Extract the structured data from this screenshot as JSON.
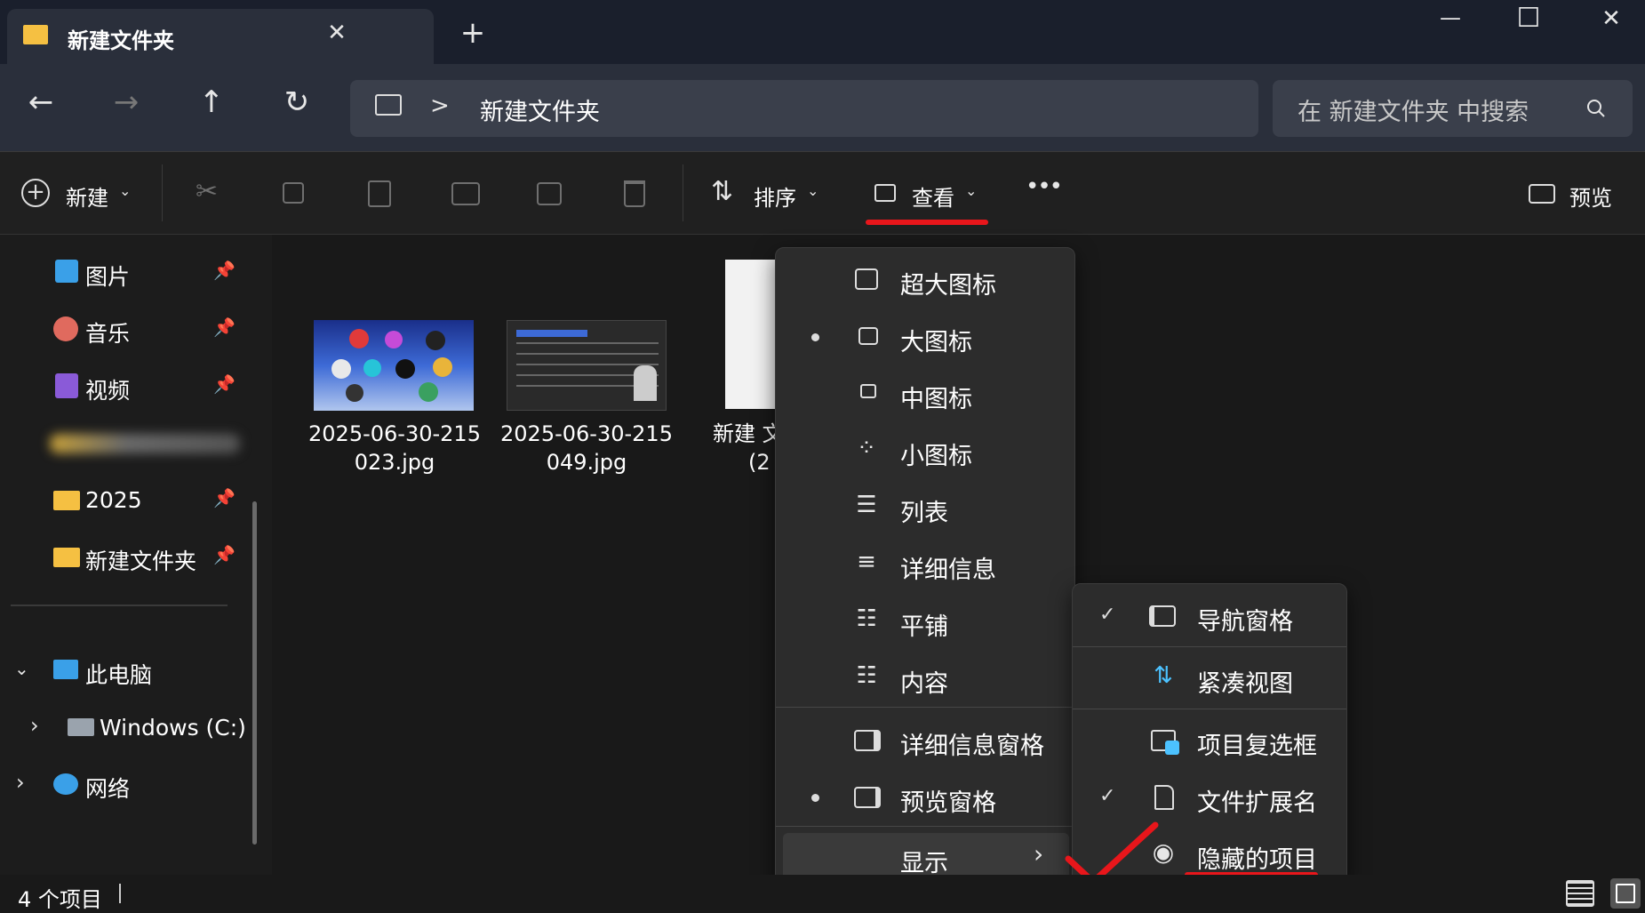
{
  "window": {
    "tab_title": "新建文件夹",
    "new_tab_symbol": "+",
    "close_tab_symbol": "✕",
    "minimize_symbol": "—",
    "maximize_symbol": "☐",
    "close_symbol": "✕"
  },
  "address_bar": {
    "path_separator": ">",
    "path": "新建文件夹",
    "search_placeholder": "在 新建文件夹 中搜索"
  },
  "toolbar": {
    "new_label": "新建",
    "sort_label": "排序",
    "view_label": "查看",
    "more_label": "•••",
    "preview_label": "预览"
  },
  "sidebar": {
    "quick_access": [
      {
        "label": "图片",
        "icon": "pictures-icon",
        "pinned": true
      },
      {
        "label": "音乐",
        "icon": "music-icon",
        "pinned": true
      },
      {
        "label": "视频",
        "icon": "videos-icon",
        "pinned": true
      },
      {
        "label": "",
        "icon": "blurred-icon",
        "pinned": false
      },
      {
        "label": "2025",
        "icon": "folder-icon",
        "pinned": true
      },
      {
        "label": "新建文件夹",
        "icon": "folder-icon",
        "pinned": true
      }
    ],
    "this_pc": "此电脑",
    "drive_c": "Windows (C:)",
    "network": "网络"
  },
  "files": [
    {
      "name_line1": "2025-06-30-215",
      "name_line2": "023.jpg"
    },
    {
      "name_line1": "2025-06-30-215",
      "name_line2": "049.jpg"
    },
    {
      "name_line1": "新建 文",
      "name_line2": "(2"
    }
  ],
  "view_menu": {
    "items": [
      {
        "label": "超大图标",
        "selected": false
      },
      {
        "label": "大图标",
        "selected": true
      },
      {
        "label": "中图标",
        "selected": false
      },
      {
        "label": "小图标",
        "selected": false
      },
      {
        "label": "列表",
        "selected": false
      },
      {
        "label": "详细信息",
        "selected": false
      },
      {
        "label": "平铺",
        "selected": false
      },
      {
        "label": "内容",
        "selected": false
      },
      {
        "label": "详细信息窗格",
        "selected": false
      },
      {
        "label": "预览窗格",
        "selected": true
      }
    ],
    "show_label": "显示"
  },
  "show_submenu": {
    "items": [
      {
        "label": "导航窗格",
        "checked": true
      },
      {
        "label": "紧凑视图",
        "checked": false
      },
      {
        "label": "项目复选框",
        "checked": false
      },
      {
        "label": "文件扩展名",
        "checked": true
      },
      {
        "label": "隐藏的项目",
        "checked": false
      }
    ]
  },
  "status": {
    "item_count": "4 个项目"
  },
  "colors": {
    "accent_red": "#e8161b",
    "folder_yellow": "#f5c042",
    "checkbox_blue": "#4cc2ff"
  }
}
